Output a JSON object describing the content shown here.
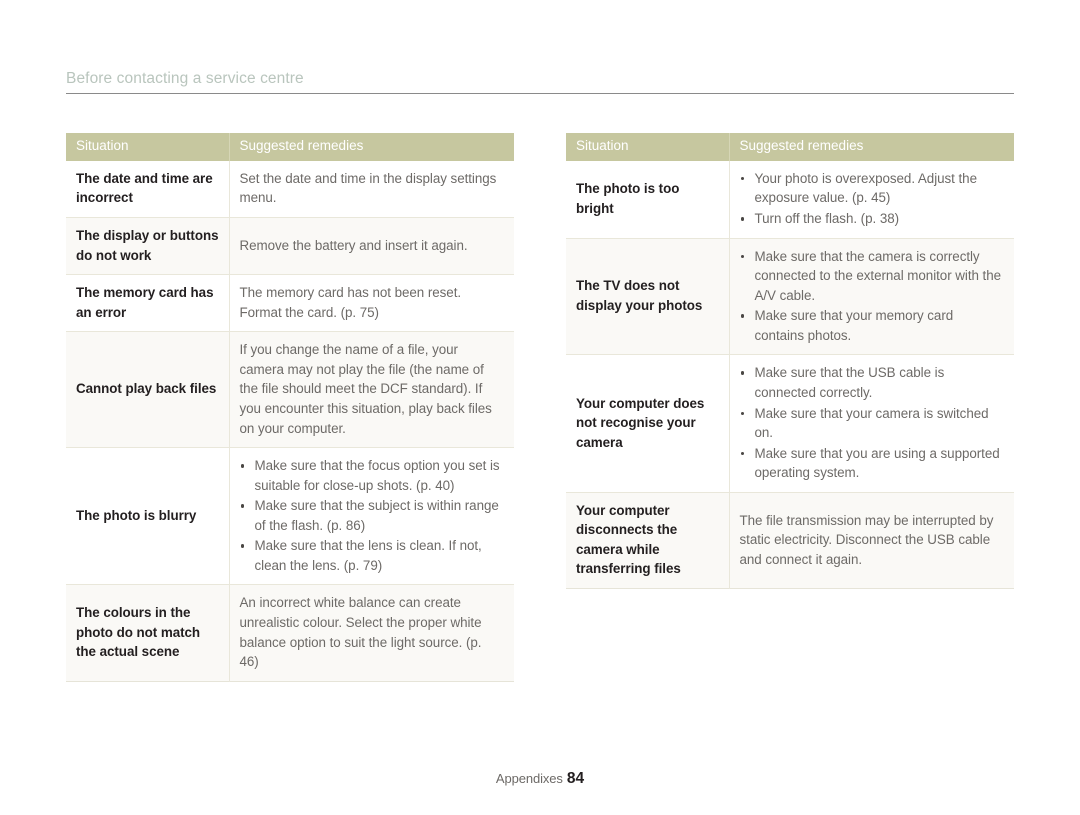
{
  "header": {
    "running_title": "Before contacting a service centre"
  },
  "colors": {
    "table_header_bg": "#c6c79f",
    "table_header_text": "#ffffff",
    "running_title": "#b9c5bd",
    "rule": "#8a8a8a",
    "row_border": "#e9e7da",
    "situation_text": "#231f20",
    "remedy_text": "#6d6a67",
    "shaded_row_bg": "#faf9f6"
  },
  "tables": [
    {
      "name": "troubleshooting-table-left",
      "columns": [
        "Situation",
        "Suggested remedies"
      ],
      "rows": [
        {
          "situation": "The date and time are incorrect",
          "remedy_type": "paragraph",
          "remedy": "Set the date and time in the display settings menu.",
          "shaded": false
        },
        {
          "situation": "The display or buttons do not work",
          "remedy_type": "paragraph",
          "remedy": "Remove the battery and insert it again.",
          "shaded": true
        },
        {
          "situation": "The memory card has an error",
          "remedy_type": "paragraph",
          "remedy": "The memory card has not been reset. Format the card. (p. 75)",
          "shaded": false
        },
        {
          "situation": "Cannot play back files",
          "remedy_type": "paragraph",
          "remedy": "If you change the name of a file, your camera may not play the file (the name of the file should meet the DCF standard). If you encounter this situation, play back files on your computer.",
          "shaded": true
        },
        {
          "situation": "The photo is blurry",
          "remedy_type": "bullets",
          "remedy_bullets": [
            "Make sure that the focus option you set is suitable for close-up shots. (p. 40)",
            "Make sure that the subject is within range of the flash. (p. 86)",
            "Make sure that the lens is clean. If not, clean the lens. (p. 79)"
          ],
          "shaded": false
        },
        {
          "situation": "The colours in the photo do not match the actual scene",
          "remedy_type": "paragraph",
          "remedy": "An incorrect white balance can create unrealistic colour. Select the proper white balance option to suit the light source. (p. 46)",
          "shaded": true
        }
      ]
    },
    {
      "name": "troubleshooting-table-right",
      "columns": [
        "Situation",
        "Suggested remedies"
      ],
      "rows": [
        {
          "situation": "The photo is too bright",
          "remedy_type": "bullets",
          "remedy_bullets": [
            "Your photo is overexposed. Adjust the exposure value. (p. 45)",
            "Turn off the flash. (p. 38)"
          ],
          "shaded": false
        },
        {
          "situation": "The TV does not display your photos",
          "remedy_type": "bullets",
          "remedy_bullets": [
            "Make sure that the camera is correctly connected to the external monitor with the A/V cable.",
            "Make sure that your memory card contains photos."
          ],
          "shaded": true
        },
        {
          "situation": "Your computer does not recognise your camera",
          "remedy_type": "bullets",
          "remedy_bullets": [
            "Make sure that the USB cable is connected correctly.",
            "Make sure that your camera is switched on.",
            "Make sure that you are using a supported operating system."
          ],
          "shaded": false
        },
        {
          "situation": "Your computer disconnects the camera while transferring files",
          "remedy_type": "paragraph",
          "remedy": "The file transmission may be interrupted by static electricity. Disconnect the USB cable and connect it again.",
          "shaded": true
        }
      ]
    }
  ],
  "footer": {
    "section": "Appendixes",
    "page_number": "84"
  }
}
